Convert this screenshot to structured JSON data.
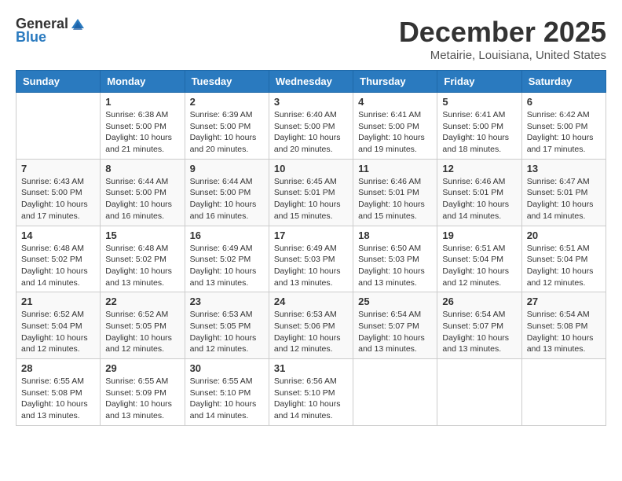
{
  "logo": {
    "general": "General",
    "blue": "Blue"
  },
  "title": "December 2025",
  "location": "Metairie, Louisiana, United States",
  "days_of_week": [
    "Sunday",
    "Monday",
    "Tuesday",
    "Wednesday",
    "Thursday",
    "Friday",
    "Saturday"
  ],
  "weeks": [
    [
      {
        "day": "",
        "sunrise": "",
        "sunset": "",
        "daylight": ""
      },
      {
        "day": "1",
        "sunrise": "Sunrise: 6:38 AM",
        "sunset": "Sunset: 5:00 PM",
        "daylight": "Daylight: 10 hours and 21 minutes."
      },
      {
        "day": "2",
        "sunrise": "Sunrise: 6:39 AM",
        "sunset": "Sunset: 5:00 PM",
        "daylight": "Daylight: 10 hours and 20 minutes."
      },
      {
        "day": "3",
        "sunrise": "Sunrise: 6:40 AM",
        "sunset": "Sunset: 5:00 PM",
        "daylight": "Daylight: 10 hours and 20 minutes."
      },
      {
        "day": "4",
        "sunrise": "Sunrise: 6:41 AM",
        "sunset": "Sunset: 5:00 PM",
        "daylight": "Daylight: 10 hours and 19 minutes."
      },
      {
        "day": "5",
        "sunrise": "Sunrise: 6:41 AM",
        "sunset": "Sunset: 5:00 PM",
        "daylight": "Daylight: 10 hours and 18 minutes."
      },
      {
        "day": "6",
        "sunrise": "Sunrise: 6:42 AM",
        "sunset": "Sunset: 5:00 PM",
        "daylight": "Daylight: 10 hours and 17 minutes."
      }
    ],
    [
      {
        "day": "7",
        "sunrise": "Sunrise: 6:43 AM",
        "sunset": "Sunset: 5:00 PM",
        "daylight": "Daylight: 10 hours and 17 minutes."
      },
      {
        "day": "8",
        "sunrise": "Sunrise: 6:44 AM",
        "sunset": "Sunset: 5:00 PM",
        "daylight": "Daylight: 10 hours and 16 minutes."
      },
      {
        "day": "9",
        "sunrise": "Sunrise: 6:44 AM",
        "sunset": "Sunset: 5:00 PM",
        "daylight": "Daylight: 10 hours and 16 minutes."
      },
      {
        "day": "10",
        "sunrise": "Sunrise: 6:45 AM",
        "sunset": "Sunset: 5:01 PM",
        "daylight": "Daylight: 10 hours and 15 minutes."
      },
      {
        "day": "11",
        "sunrise": "Sunrise: 6:46 AM",
        "sunset": "Sunset: 5:01 PM",
        "daylight": "Daylight: 10 hours and 15 minutes."
      },
      {
        "day": "12",
        "sunrise": "Sunrise: 6:46 AM",
        "sunset": "Sunset: 5:01 PM",
        "daylight": "Daylight: 10 hours and 14 minutes."
      },
      {
        "day": "13",
        "sunrise": "Sunrise: 6:47 AM",
        "sunset": "Sunset: 5:01 PM",
        "daylight": "Daylight: 10 hours and 14 minutes."
      }
    ],
    [
      {
        "day": "14",
        "sunrise": "Sunrise: 6:48 AM",
        "sunset": "Sunset: 5:02 PM",
        "daylight": "Daylight: 10 hours and 14 minutes."
      },
      {
        "day": "15",
        "sunrise": "Sunrise: 6:48 AM",
        "sunset": "Sunset: 5:02 PM",
        "daylight": "Daylight: 10 hours and 13 minutes."
      },
      {
        "day": "16",
        "sunrise": "Sunrise: 6:49 AM",
        "sunset": "Sunset: 5:02 PM",
        "daylight": "Daylight: 10 hours and 13 minutes."
      },
      {
        "day": "17",
        "sunrise": "Sunrise: 6:49 AM",
        "sunset": "Sunset: 5:03 PM",
        "daylight": "Daylight: 10 hours and 13 minutes."
      },
      {
        "day": "18",
        "sunrise": "Sunrise: 6:50 AM",
        "sunset": "Sunset: 5:03 PM",
        "daylight": "Daylight: 10 hours and 13 minutes."
      },
      {
        "day": "19",
        "sunrise": "Sunrise: 6:51 AM",
        "sunset": "Sunset: 5:04 PM",
        "daylight": "Daylight: 10 hours and 12 minutes."
      },
      {
        "day": "20",
        "sunrise": "Sunrise: 6:51 AM",
        "sunset": "Sunset: 5:04 PM",
        "daylight": "Daylight: 10 hours and 12 minutes."
      }
    ],
    [
      {
        "day": "21",
        "sunrise": "Sunrise: 6:52 AM",
        "sunset": "Sunset: 5:04 PM",
        "daylight": "Daylight: 10 hours and 12 minutes."
      },
      {
        "day": "22",
        "sunrise": "Sunrise: 6:52 AM",
        "sunset": "Sunset: 5:05 PM",
        "daylight": "Daylight: 10 hours and 12 minutes."
      },
      {
        "day": "23",
        "sunrise": "Sunrise: 6:53 AM",
        "sunset": "Sunset: 5:05 PM",
        "daylight": "Daylight: 10 hours and 12 minutes."
      },
      {
        "day": "24",
        "sunrise": "Sunrise: 6:53 AM",
        "sunset": "Sunset: 5:06 PM",
        "daylight": "Daylight: 10 hours and 12 minutes."
      },
      {
        "day": "25",
        "sunrise": "Sunrise: 6:54 AM",
        "sunset": "Sunset: 5:07 PM",
        "daylight": "Daylight: 10 hours and 13 minutes."
      },
      {
        "day": "26",
        "sunrise": "Sunrise: 6:54 AM",
        "sunset": "Sunset: 5:07 PM",
        "daylight": "Daylight: 10 hours and 13 minutes."
      },
      {
        "day": "27",
        "sunrise": "Sunrise: 6:54 AM",
        "sunset": "Sunset: 5:08 PM",
        "daylight": "Daylight: 10 hours and 13 minutes."
      }
    ],
    [
      {
        "day": "28",
        "sunrise": "Sunrise: 6:55 AM",
        "sunset": "Sunset: 5:08 PM",
        "daylight": "Daylight: 10 hours and 13 minutes."
      },
      {
        "day": "29",
        "sunrise": "Sunrise: 6:55 AM",
        "sunset": "Sunset: 5:09 PM",
        "daylight": "Daylight: 10 hours and 13 minutes."
      },
      {
        "day": "30",
        "sunrise": "Sunrise: 6:55 AM",
        "sunset": "Sunset: 5:10 PM",
        "daylight": "Daylight: 10 hours and 14 minutes."
      },
      {
        "day": "31",
        "sunrise": "Sunrise: 6:56 AM",
        "sunset": "Sunset: 5:10 PM",
        "daylight": "Daylight: 10 hours and 14 minutes."
      },
      {
        "day": "",
        "sunrise": "",
        "sunset": "",
        "daylight": ""
      },
      {
        "day": "",
        "sunrise": "",
        "sunset": "",
        "daylight": ""
      },
      {
        "day": "",
        "sunrise": "",
        "sunset": "",
        "daylight": ""
      }
    ]
  ]
}
